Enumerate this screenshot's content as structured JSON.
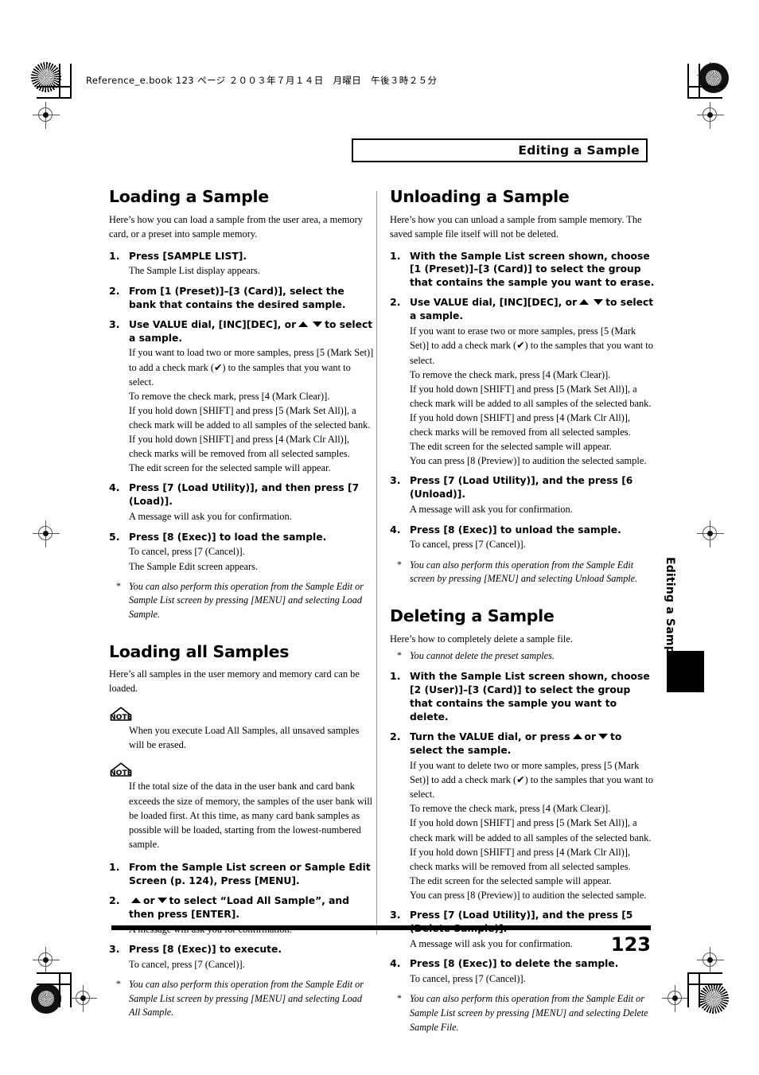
{
  "book_info": "Reference_e.book  123 ページ  ２００３年７月１４日　月曜日　午後３時２５分",
  "running_head": "Editing a Sample",
  "side_tab": "Editing a Sample",
  "page_number": "123",
  "sections": {
    "loading_a_sample": {
      "title": "Loading a Sample",
      "intro": "Here’s how you can load a sample from the user area, a memory card, or a preset into sample memory.",
      "steps": [
        {
          "num": "1.",
          "head": "Press [SAMPLE LIST].",
          "lines": [
            "The Sample List display appears."
          ]
        },
        {
          "num": "2.",
          "head": "From [1 (Preset)]–[3 (Card)], select the bank that contains the desired sample.",
          "lines": []
        },
        {
          "num": "3.",
          "head_pre": "Use VALUE dial, [INC][DEC], or",
          "head_post": "to select a sample.",
          "lines": [
            "If you want to load two or more samples, press [5 (Mark Set)] to add a check mark (✔) to the samples that you want to select.",
            "To remove the check mark, press [4 (Mark Clear)].",
            "If you hold down [SHIFT] and press [5 (Mark Set All)], a check mark will be added to all samples of the selected bank. If you hold down [SHIFT] and press [4 (Mark Clr All)], check marks will be removed from all selected samples.",
            "The edit screen for the selected sample will appear."
          ]
        },
        {
          "num": "4.",
          "head": "Press [7 (Load Utility)], and then press [7 (Load)].",
          "lines": [
            "A message will ask you for confirmation."
          ]
        },
        {
          "num": "5.",
          "head": "Press [8 (Exec)] to load the sample.",
          "lines": [
            "To cancel, press [7 (Cancel)].",
            "The Sample Edit screen appears."
          ]
        }
      ],
      "footnote": "You can also perform this operation from the Sample Edit or Sample List screen by pressing [MENU] and selecting Load Sample."
    },
    "loading_all_samples": {
      "title": "Loading all Samples",
      "intro": "Here’s all samples in the user memory and memory card can be loaded.",
      "note_icon_label": "NOTE",
      "note1": "When you execute Load All Samples, all unsaved samples will be erased.",
      "note2": "If the total size of the data in the user bank and card bank exceeds the size of memory, the samples of the user bank will be loaded first. At this time, as many card bank samples as possible will be loaded, starting from the lowest-numbered sample.",
      "steps": [
        {
          "num": "1.",
          "head": "From the Sample List screen or Sample Edit Screen (p. 124), Press [MENU].",
          "lines": []
        },
        {
          "num": "2.",
          "head_pre": "",
          "head_mid": "or",
          "head_post": "to select “Load All Sample”, and then press [ENTER].",
          "lines": [
            "A message will ask you for confirmation."
          ]
        },
        {
          "num": "3.",
          "head": "Press [8 (Exec)] to execute.",
          "lines": [
            "To cancel, press [7 (Cancel)]."
          ]
        }
      ],
      "footnote": "You can also perform this operation from the Sample Edit or Sample List screen by pressing [MENU] and selecting Load All Sample."
    },
    "unloading_a_sample": {
      "title": "Unloading a Sample",
      "intro": "Here’s how you can unload a sample from sample memory. The saved sample file itself will not be deleted.",
      "steps": [
        {
          "num": "1.",
          "head": "With the Sample List screen shown, choose [1 (Preset)]–[3 (Card)] to select the group that contains the sample you want to erase.",
          "lines": []
        },
        {
          "num": "2.",
          "head_pre": "Use VALUE dial, [INC][DEC], or",
          "head_post": "to select a sample.",
          "lines": [
            "If you want to erase two or more samples, press [5 (Mark Set)] to add a check mark (✔) to the samples that you want to select.",
            "To remove the check mark, press [4 (Mark Clear)].",
            "If you hold down [SHIFT] and press [5 (Mark Set All)], a check mark will be added to all samples of the selected bank. If you hold down [SHIFT] and press [4 (Mark Clr All)], check marks will be removed from all selected samples.",
            "The edit screen for the selected sample will appear.",
            "You can press [8 (Preview)] to audition the selected sample."
          ]
        },
        {
          "num": "3.",
          "head": "Press [7 (Load Utility)], and the press [6 (Unload)].",
          "lines": [
            "A message will ask you for confirmation."
          ]
        },
        {
          "num": "4.",
          "head": "Press [8 (Exec)] to unload the sample.",
          "lines": [
            "To cancel, press [7 (Cancel)]."
          ]
        }
      ],
      "footnote": "You can also perform this operation from the Sample Edit screen by pressing [MENU] and selecting Unload Sample."
    },
    "deleting_a_sample": {
      "title": "Deleting a Sample",
      "intro": "Here’s how to completely delete a sample file.",
      "pre_footnote": "You cannot delete the preset samples.",
      "steps": [
        {
          "num": "1.",
          "head": "With the Sample List screen shown, choose [2 (User)]–[3 (Card)] to select the group that contains the sample you want to delete.",
          "lines": []
        },
        {
          "num": "2.",
          "head_pre": "Turn the VALUE dial, or press",
          "head_mid": "or",
          "head_post": "to select the sample.",
          "lines": [
            "If you want to delete two or more samples, press [5 (Mark Set)] to add a check mark (✔) to the samples that you want to select.",
            "To remove the check mark, press [4 (Mark Clear)].",
            "If you hold down [SHIFT] and press [5 (Mark Set All)], a check mark will be added to all samples of the selected bank. If you hold down [SHIFT] and press [4 (Mark Clr All)], check marks will be removed from all selected samples.",
            "The edit screen for the selected sample will appear.",
            "You can press [8 (Preview)] to audition the selected sample."
          ]
        },
        {
          "num": "3.",
          "head": "Press [7 (Load Utility)], and the press [5 (Delete Sample)].",
          "lines": [
            "A message will ask you for confirmation."
          ]
        },
        {
          "num": "4.",
          "head": "Press [8 (Exec)] to delete the sample.",
          "lines": [
            "To cancel, press [7 (Cancel)]."
          ]
        }
      ],
      "footnote": "You can also perform this operation from the Sample Edit or Sample List screen by pressing [MENU] and selecting Delete Sample File."
    }
  }
}
